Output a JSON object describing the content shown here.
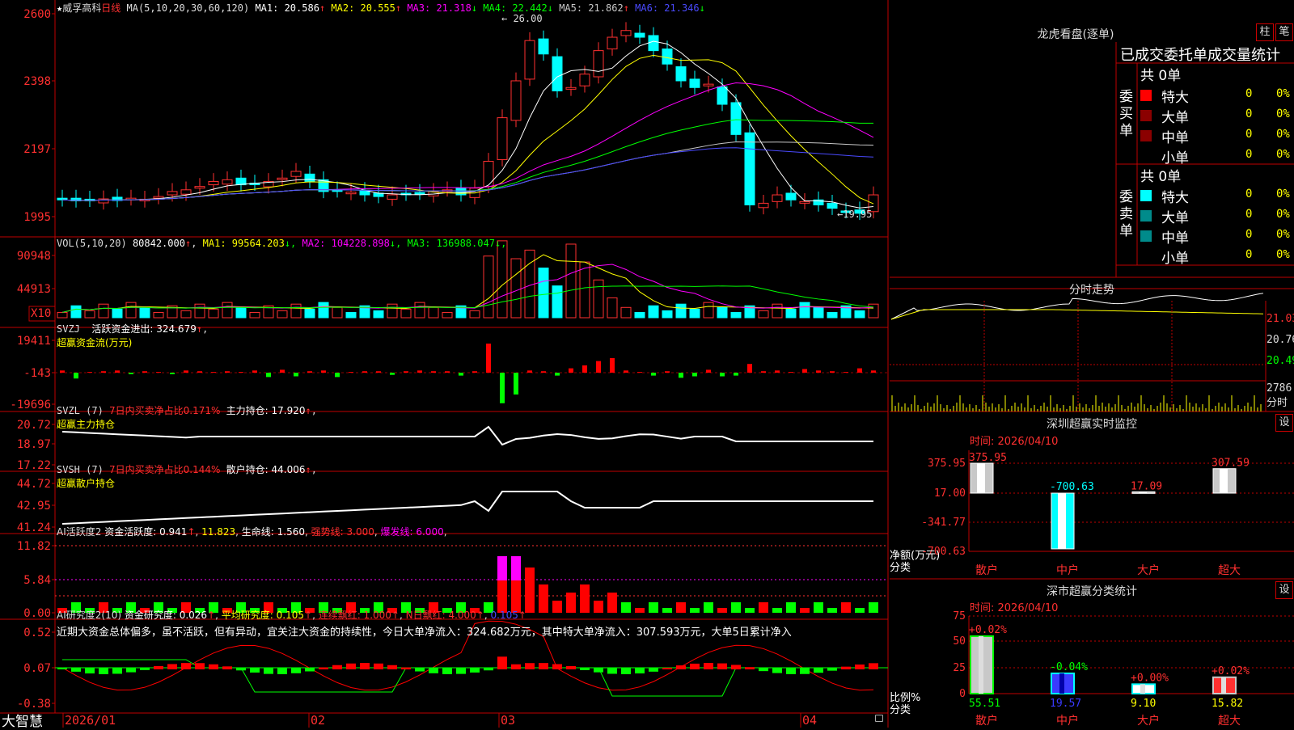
{
  "stock": {
    "name": "威孚高科",
    "period": "日线",
    "ma_params": "MA(5,10,20,30,60,120)",
    "ma_values": [
      {
        "label": "MA1:",
        "value": "20.586",
        "arrow": "↑",
        "color": "#ffffff"
      },
      {
        "label": "MA2:",
        "value": "20.555",
        "arrow": "↑",
        "color": "#ffff00"
      },
      {
        "label": "MA3:",
        "value": "21.318",
        "arrow": "↓",
        "color": "#ff00ff"
      },
      {
        "label": "MA4:",
        "value": "22.442",
        "arrow": "↓",
        "color": "#00ff00"
      },
      {
        "label": "MA5:",
        "value": "21.862",
        "arrow": "↑",
        "color": "#c8c8c8"
      },
      {
        "label": "MA6:",
        "value": "21.346",
        "arrow": "↓",
        "color": "#4a4aff"
      }
    ],
    "high_label": "26.00",
    "low_label": "19.95",
    "price_axis": [
      "2600",
      "2398",
      "2197",
      "1995"
    ]
  },
  "vol": {
    "params": "VOL(5,10,20)",
    "value": "80842.000",
    "ma": [
      {
        "label": "MA1:",
        "value": "99564.203",
        "arrow": "↓",
        "color": "#ffff00"
      },
      {
        "label": "MA2:",
        "value": "104228.898",
        "arrow": "↓",
        "color": "#ff00ff"
      },
      {
        "label": "MA3:",
        "value": "136988.047",
        "arrow": "↓",
        "color": "#00ff00"
      }
    ],
    "axis": [
      "90948",
      "44913"
    ],
    "unit": "X10"
  },
  "svzj": {
    "name": "SVZJ",
    "desc": "活跃资金进出: 324.679",
    "arrow": "↑",
    "sub": "超赢资金流(万元)",
    "axis": [
      "19411",
      "-143",
      "-19696"
    ]
  },
  "svzl": {
    "name": "SVZL (7)",
    "ratio": "7日内买卖净占比0.171%",
    "hold": "主力持仓: 17.920",
    "sub": "超赢主力持仓",
    "axis": [
      "20.72",
      "18.97",
      "17.22"
    ]
  },
  "svsh": {
    "name": "SVSH (7)",
    "ratio": "7日内买卖净占比0.144%",
    "hold": "散户持仓: 44.006",
    "sub": "超赢散户持仓",
    "axis": [
      "44.72",
      "42.95",
      "41.24"
    ]
  },
  "ai1": {
    "name": "AI活跃度2",
    "act": "资金活跃度: 0.941",
    "v2": "11.823",
    "life": "生命线: 1.560",
    "strong": "强势线: 3.000",
    "burst": "爆发线: 6.000",
    "axis": [
      "11.82",
      "5.84",
      "0.00"
    ]
  },
  "ai2": {
    "name": "AI研究度2(10)",
    "res": "资金研究度: 0.026",
    "avg": "平均研究度: 0.105",
    "cont": "连续飘红: 1.000",
    "nday": "N日飘红: 4.000",
    "last": "0.105",
    "comment": "近期大资金总体偏多，虽不活跃，但有异动，宜关注大资金的持续性，今日大单净流入：324.682万元，其中特大单净流入：307.593万元，大单5日累计净入",
    "axis": [
      "0.52",
      "0.07",
      "-0.38"
    ]
  },
  "date_axis": [
    "2026/01",
    "02",
    "03",
    "04"
  ],
  "brand": "大智慧",
  "right": {
    "lhb_title": "龙虎看盘(逐单)",
    "btn_zhu": "柱",
    "btn_bi": "笔",
    "stat_title": "已成交委托单成交量统计",
    "buy_label": "委买单",
    "sell_label": "委卖单",
    "buy_total": "共 0单",
    "sell_total": "共 0单",
    "rows": [
      "特大",
      "大单",
      "中单",
      "小单"
    ],
    "zero": "0",
    "pct": "0%",
    "fs_title": "分时走势",
    "fs_axis": [
      "21.03",
      "20.76",
      "20.49",
      "2786",
      "分时"
    ],
    "sz_title": "深圳超赢实时监控",
    "sz_time": "时间: 2026/04/10",
    "sz_axis": [
      "375.95",
      "17.00",
      "-341.77",
      "-700.63"
    ],
    "sz_vals": [
      "375.95",
      "-700.63",
      "17.09",
      "307.59"
    ],
    "sz_ylabel": "净额(万元)",
    "sz_xlabel": "分类",
    "cats": [
      "散户",
      "中户",
      "大户",
      "超大"
    ],
    "fl_title": "深市超赢分类统计",
    "fl_time": "时间: 2026/04/10",
    "fl_axis": [
      "75",
      "50",
      "25",
      "0"
    ],
    "fl_pcts": [
      "+0.02%",
      "-0.04%",
      "+0.00%",
      "+0.02%"
    ],
    "fl_vals": [
      "55.51",
      "19.57",
      "9.10",
      "15.82"
    ],
    "fl_ylabel": "比例%",
    "fl_xlabel": "分类",
    "set_btn": "设"
  }
}
